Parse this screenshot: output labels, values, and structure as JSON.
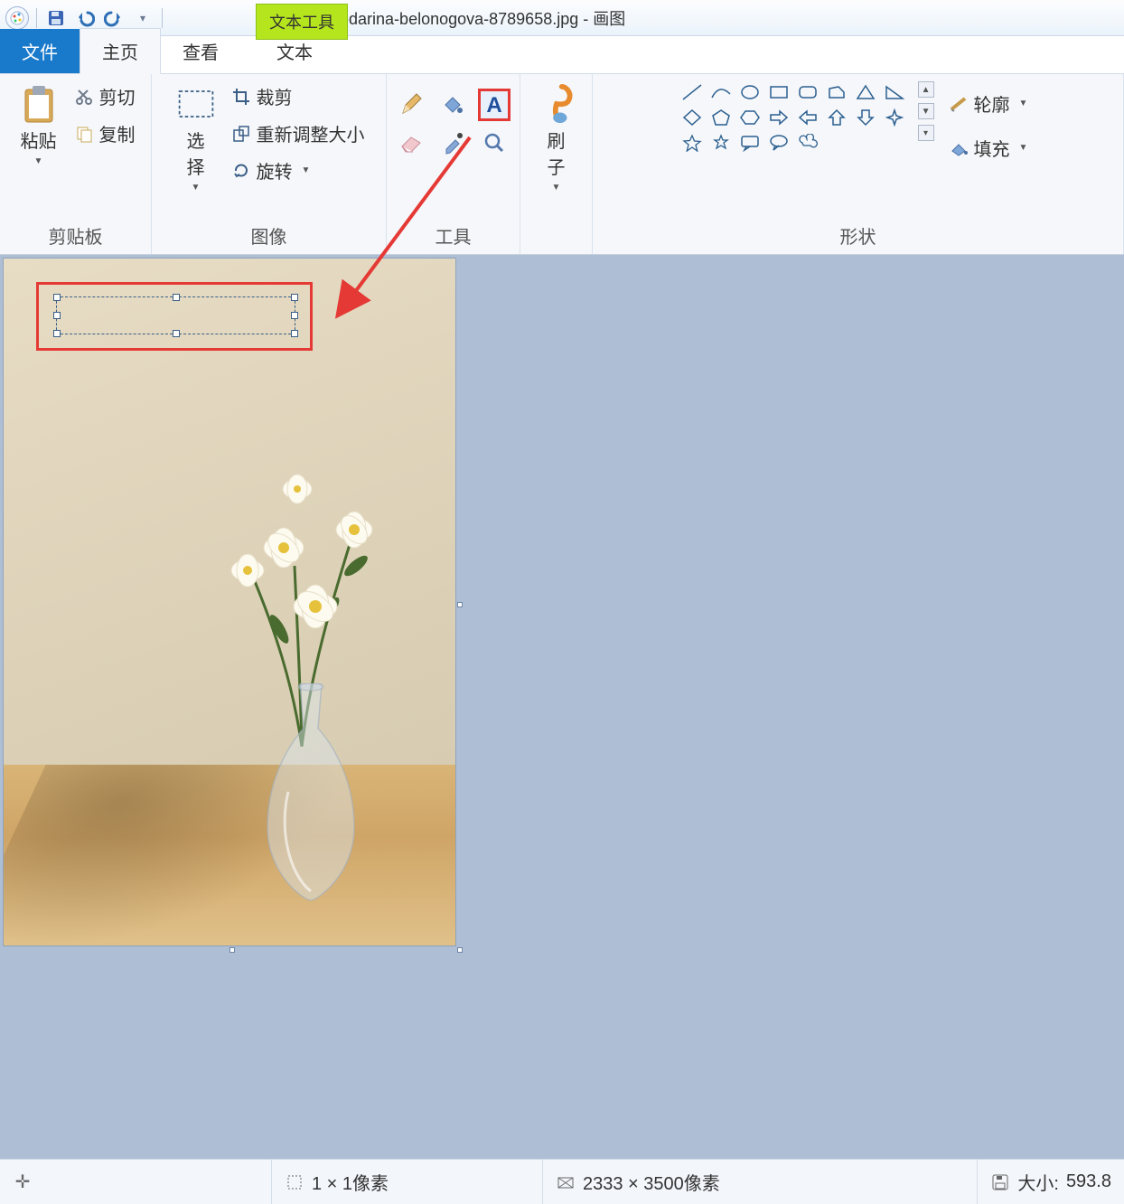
{
  "title": {
    "context_tab": "文本工具",
    "filename": "pexels-darina-belonogova-8789658.jpg",
    "app": "画图"
  },
  "tabs": {
    "file": "文件",
    "home": "主页",
    "view": "查看",
    "text": "文本"
  },
  "ribbon": {
    "clipboard": {
      "label": "剪贴板",
      "paste": "粘贴",
      "cut": "剪切",
      "copy": "复制"
    },
    "image": {
      "label": "图像",
      "select": "选\n择",
      "crop": "裁剪",
      "resize": "重新调整大小",
      "rotate": "旋转"
    },
    "tools": {
      "label": "工具"
    },
    "brush": {
      "label": "刷\n子"
    },
    "shapes": {
      "label": "形状",
      "outline": "轮廓",
      "fill": "填充"
    }
  },
  "status": {
    "cursor_icon": "✛",
    "selection": "1 × 1像素",
    "dimensions": "2333 × 3500像素",
    "size_label": "大小:",
    "size_value": "593.8"
  }
}
